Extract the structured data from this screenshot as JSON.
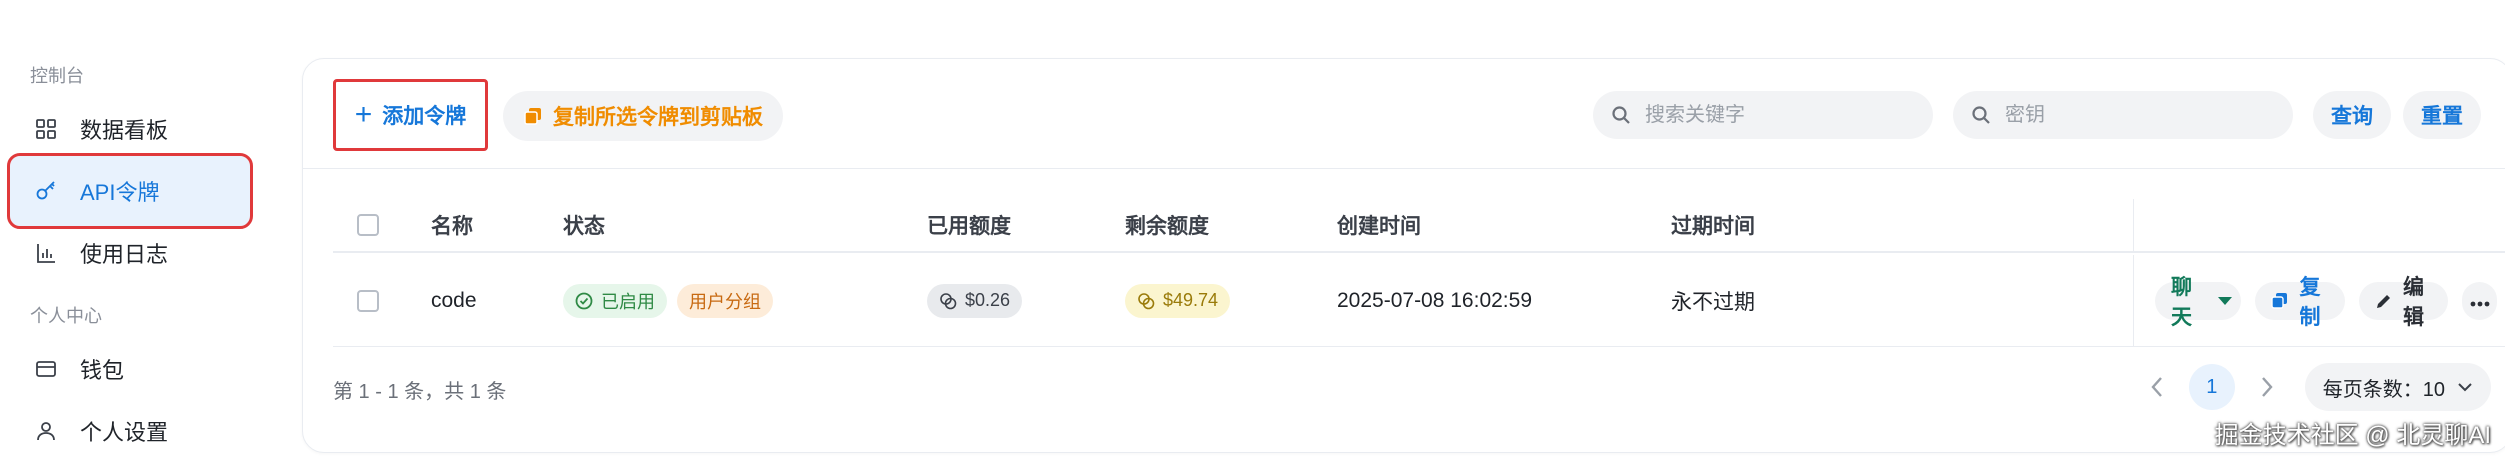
{
  "sidebar": {
    "section_console": "控制台",
    "section_personal": "个人中心",
    "items": [
      {
        "label": "数据看板",
        "icon": "dashboard-icon"
      },
      {
        "label": "API令牌",
        "icon": "key-icon",
        "active": true
      },
      {
        "label": "使用日志",
        "icon": "bar-chart-icon"
      },
      {
        "label": "钱包",
        "icon": "wallet-icon"
      },
      {
        "label": "个人设置",
        "icon": "user-icon"
      }
    ]
  },
  "toolbar": {
    "add_token_label": "添加令牌",
    "copy_selected_label": "复制所选令牌到剪贴板",
    "search_keyword_placeholder": "搜索关键字",
    "search_key_placeholder": "密钥",
    "query_label": "查询",
    "reset_label": "重置"
  },
  "table": {
    "headers": {
      "name": "名称",
      "status": "状态",
      "used_quota": "已用额度",
      "remaining_quota": "剩余额度",
      "created_time": "创建时间",
      "expire_time": "过期时间"
    },
    "rows": [
      {
        "name": "code",
        "status": "已启用",
        "group": "用户分组",
        "used_quota": "$0.26",
        "remaining_quota": "$49.74",
        "created_time": "2025-07-08 16:02:59",
        "expire_time": "永不过期",
        "actions": {
          "chat": "聊天",
          "copy": "复制",
          "edit": "编辑"
        }
      }
    ]
  },
  "pagination": {
    "summary": "第 1 - 1 条，共 1 条",
    "current_page": "1",
    "page_size_label": "每页条数：10"
  },
  "watermark": "掘金技术社区 @ 北灵聊AI",
  "colors": {
    "accent": "#1677d9",
    "highlight_border": "#e0393b",
    "copy_selected": "#f08c00",
    "status_enabled": "#2f8a45",
    "chat": "#127a5a"
  }
}
